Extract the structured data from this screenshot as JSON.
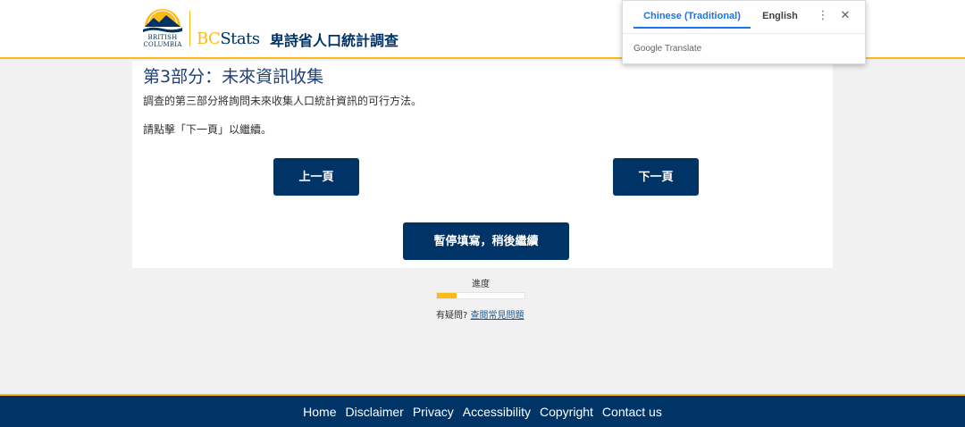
{
  "header": {
    "logo_line1": "BRITISH",
    "logo_line2": "COLUMBIA",
    "brand_bc": "BC",
    "brand_stats": "Stats",
    "title": "卑詩省人口統計調查"
  },
  "translate": {
    "tab_active": "Chinese (Traditional)",
    "tab_inactive": "English",
    "more_glyph": "⋮",
    "close_glyph": "✕",
    "brand": "Google Translate"
  },
  "main": {
    "section_title": "第3部分：未來資訊收集",
    "paragraph1": "調查的第三部分將詢問未來收集人口統計資訊的可行方法。",
    "paragraph2": "請點擊「下一頁」以繼續。",
    "prev_label": "上一頁",
    "next_label": "下一頁",
    "pause_label": "暫停填寫，稍後繼續"
  },
  "progress": {
    "label": "進度",
    "fraction": 0.22,
    "faq_prefix": "有疑問?",
    "faq_link": "查閱常見問題"
  },
  "footer": {
    "links": [
      "Home",
      "Disclaimer",
      "Privacy",
      "Accessibility",
      "Copyright",
      "Contact us"
    ]
  },
  "colors": {
    "navy": "#003366",
    "gold": "#fcba19",
    "link": "#1a5a96",
    "translate_blue": "#1a73e8"
  },
  "icons": {
    "logo": "bc-sun-mountains-logo",
    "more": "more-vert-icon",
    "close": "close-icon"
  }
}
